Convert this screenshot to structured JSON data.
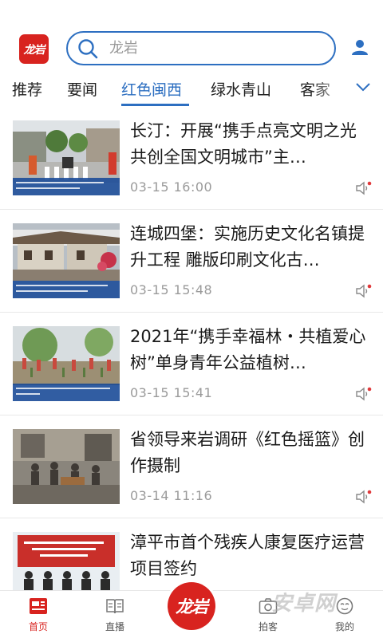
{
  "header": {
    "logo_text": "龙岩",
    "search_placeholder": "龙岩",
    "icons": {
      "search": "search-icon",
      "user": "user-icon"
    }
  },
  "tabs": [
    {
      "label": "推荐",
      "active": false
    },
    {
      "label": "要闻",
      "active": false
    },
    {
      "label": "红色闽西",
      "active": true
    },
    {
      "label": "绿水青山",
      "active": false
    },
    {
      "label": "客家",
      "active": false
    }
  ],
  "news": [
    {
      "title": "长汀：开展“携手点亮文明之光 共创全国文明城市”主…",
      "time": "03-15  16:00"
    },
    {
      "title": "连城四堡：实施历史文化名镇提升工程 雕版印刷文化古…",
      "time": "03-15  15:48"
    },
    {
      "title": "2021年“携手幸福林・共植爱心树”单身青年公益植树…",
      "time": "03-15  15:41"
    },
    {
      "title": "省领导来岩调研《红色摇篮》创作摄制",
      "time": "03-14  11:16"
    },
    {
      "title": "漳平市首个残疾人康复医疗运营项目签约",
      "time": ""
    }
  ],
  "bottom_nav": {
    "home": "首页",
    "live": "直播",
    "center": "龙岩",
    "shoot": "拍客",
    "mine": "我的"
  },
  "watermark": "安卓网",
  "colors": {
    "accent_blue": "#2d6fc1",
    "brand_red": "#d8231f"
  }
}
